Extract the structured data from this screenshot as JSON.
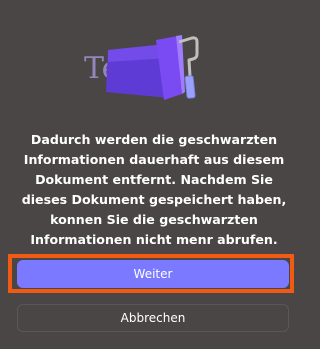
{
  "dialog": {
    "illustration_icon": "text-paint-roller-illustration",
    "illustration_text": "Text",
    "message": "Dadurch werden die geschwarzten Informationen dauerhaft aus diesem Dokument entfernt. Nachdem Sie dieses Dokument gespeichert haben, konnen Sie die geschwarzten Informationen nicht menr abrufen.",
    "primary_button": "Weiter",
    "secondary_button": "Abbrechen"
  },
  "colors": {
    "background": "#4b4646",
    "accent": "#7a79ff",
    "highlight": "#f05a12",
    "roller_handle": "#9aa0ff"
  }
}
